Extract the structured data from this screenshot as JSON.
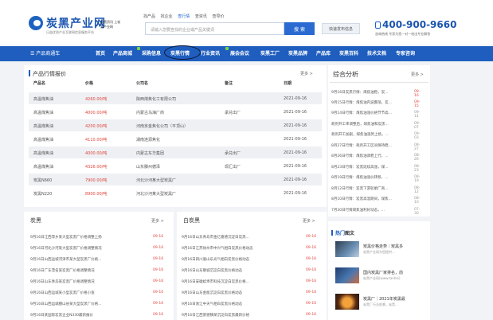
{
  "header": {
    "logo_title": "炭黑产业网",
    "logo_sub": "日益优质产业互联网信息服务平台",
    "slogan": "炭黑资讯 上炭黑产业网",
    "search_tabs": [
      "找产品",
      "找企业",
      "查行情",
      "查资讯",
      "查导价"
    ],
    "search_placeholder": "请输入您要查找的企业或产品关键词",
    "search_button": "搜 索",
    "publish_button": "快速发布信息",
    "phone": "400-900-9660",
    "phone_sub": "咨询热线 专家为您一对一给出专业解答"
  },
  "nav": {
    "market": "产品商通车",
    "items": [
      "首页",
      "产品商城",
      "采购信息",
      "炭黑行情",
      "行业资讯",
      "展会会议",
      "炭黑工厂",
      "炭黑品牌",
      "产品库",
      "炭黑百科",
      "技术文档",
      "专家咨询"
    ]
  },
  "price_table": {
    "title": "产品行情报价",
    "more": "更多 >",
    "headers": [
      "产品名",
      "价格",
      "公司名",
      "备注",
      "日期"
    ],
    "rows": [
      [
        "高温煤焦油",
        "4260.00/吨",
        "陕西煤焦化工有限公司",
        "",
        "2021-09-16"
      ],
      [
        "高温煤焦油",
        "4000.00/吨",
        "内蒙古乌海厂商",
        "承兑出厂",
        "2021-09-16"
      ],
      [
        "高温煤焦油",
        "4200.00/吨",
        "河南京金焦化公司（平顶山）",
        "",
        "2021-09-16"
      ],
      [
        "高温煤焦油",
        "4110.00/吨",
        "湖南连源焦化",
        "",
        "2021-09-16"
      ],
      [
        "高温煤焦油",
        "4000.00/吨",
        "内蒙古东华集团",
        "承兑出厂",
        "2021-09-16"
      ],
      [
        "高温煤焦油",
        "4326.00/吨",
        "山东滕州德泽",
        "现汇出厂",
        "2021-09-16"
      ],
      [
        "炭黑N660",
        "7900.00/吨",
        "河北沙河某大型炭黑厂",
        "",
        "2021-09-16"
      ],
      [
        "炭黑N220",
        "8900.00/吨",
        "河北沙河某大型炭黑厂",
        "",
        "2021-09-16"
      ]
    ]
  },
  "analysis": {
    "title": "综合分析",
    "more": "更多 >",
    "items": [
      {
        "text": "9月16日炭黑行情：煤焦油稳，炭...",
        "date": "09-16"
      },
      {
        "text": "9月15日行情：煤焦油内波震荡，炭...",
        "date": "09-15"
      },
      {
        "text": "9月14日行情：煤焦油涨价格节节高...",
        "date": "09-14"
      },
      {
        "text": "耗剂开工率调整后，煤焦油和炭黑...",
        "date": "09-07"
      },
      {
        "text": "耗剂开工加剧，煤焦油涨势上扬，...",
        "date": "09-03"
      },
      {
        "text": "8月27日行情：耗剂开工区间保持稳...",
        "date": "08-27"
      },
      {
        "text": "8月26日行情：煤焦油调稳上行，...",
        "date": "08-26"
      },
      {
        "text": "8月23日行情：炭黑延续高涨，煤...",
        "date": "08-23"
      },
      {
        "text": "8月19日行情：煤焦油涨价转移，...",
        "date": "08-19"
      },
      {
        "text": "8月12日行情：炭黑下游轮胎厂商...",
        "date": "08-12"
      },
      {
        "text": "8月10日行情：炭黑高温期间，煤焦...",
        "date": "08-10"
      },
      {
        "text": "7月30日行情煤焦油利好动态，...",
        "date": "07-30"
      }
    ]
  },
  "news_left": {
    "title": "炭黑",
    "more": "更多 >",
    "items": [
      {
        "text": "9月16日江西萍乡某大型炭黑厂价格调整上扬",
        "date": "09-16"
      },
      {
        "text": "9月16日河北沙河某大型炭黑厂价格调整情况",
        "date": "09-16"
      },
      {
        "text": "9月16日山西运城河津市某大型炭黑厂价格...",
        "date": "09-16"
      },
      {
        "text": "9月16日广东茂名某炭黑厂价格调整情况",
        "date": "09-16"
      },
      {
        "text": "9月16日山东青岛某炭黑厂价格调整情况",
        "date": "09-16"
      },
      {
        "text": "9月16日山西运城某小型炭黑厂价格小涨",
        "date": "09-16"
      },
      {
        "text": "9月16日山西运城稷山县某大型炭黑厂价格...",
        "date": "09-16"
      },
      {
        "text": "9月16日某国际炭黑企业N330最新报价",
        "date": "09-16"
      }
    ]
  },
  "news_right": {
    "title": "白炭黑",
    "more": "更多 >",
    "items": [
      {
        "text": "9月16日山东青岛市金亿嘉德沉淀白炭黑...",
        "date": "09-16"
      },
      {
        "text": "9月16日江苏徐州市中兴气相白炭黑价格动态",
        "date": "09-16"
      },
      {
        "text": "9月16日四川眉山乐光气相白炭黑价格动态",
        "date": "09-16"
      },
      {
        "text": "9月16日山东聊城沉淀白炭黑价格动态",
        "date": "09-16"
      },
      {
        "text": "9月16日安徽蚌埠市科技沉淀白炭黑价格...",
        "date": "09-16"
      },
      {
        "text": "9月16日山东金能沉淀白炭黑价格动态",
        "date": "09-16"
      },
      {
        "text": "9月16日浙江中天气相白炭黑价格动态",
        "date": "09-16"
      },
      {
        "text": "9月16日江西景德镇某沉淀白炭黑最新价格",
        "date": "09-16"
      }
    ]
  },
  "hot": {
    "title_a": "热门",
    "title_b": "图文",
    "items": [
      {
        "title": "炭黑价格走势｜炭黑多",
        "sub": "炭黑产业网为您提供..."
      },
      {
        "title": "国内炭黑厂家排名，前",
        "sub": "炭黑产业网(www.tanhei)"
      },
      {
        "title": "炭黑厂｜2021年炭黑最",
        "sub": "炭黑厂行业前景，炭黑..."
      }
    ]
  },
  "colors": {
    "brand": "#1f5ebf",
    "price": "#e0463c",
    "hot_dot": "#7ed14b"
  }
}
